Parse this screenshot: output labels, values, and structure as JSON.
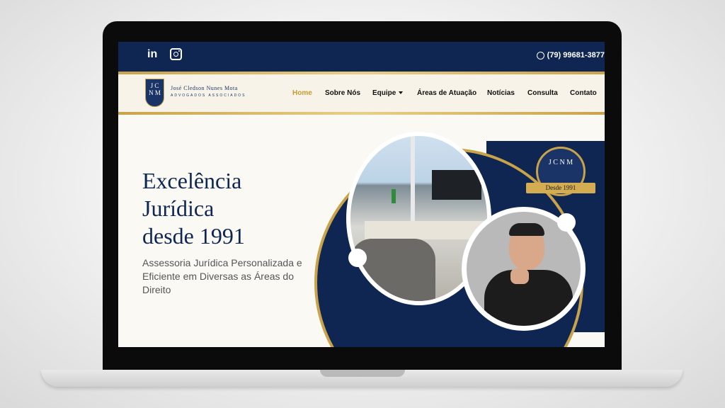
{
  "topbar": {
    "social": [
      "in",
      "instagram"
    ],
    "phone": "(79) 99681-3877",
    "phone_icon": "whatsapp-icon"
  },
  "brand": {
    "emblem_letters": [
      "J",
      "C",
      "N",
      "M"
    ],
    "name": "José Cledson Nunes Mota",
    "tagline": "ADVOGADOS ASSOCIADOS"
  },
  "nav": {
    "items": [
      "Home",
      "Sobre Nós",
      "Equipe",
      "Áreas de Atuação",
      "Notícias",
      "Consulta",
      "Contato"
    ],
    "active": "Home"
  },
  "hero": {
    "title_line1": "Excelência",
    "title_line2": "Jurídica",
    "title_line3": "desde 1991",
    "subtitle": "Assessoria Jurídica Personalizada e Eficiente em Diversas as Áreas do Direito"
  },
  "seal": {
    "letters": "J C N M",
    "ribbon": "Desde 1991"
  },
  "colors": {
    "navy": "#0f2652",
    "gold": "#c9a34a",
    "background": "#fbf9f4"
  }
}
